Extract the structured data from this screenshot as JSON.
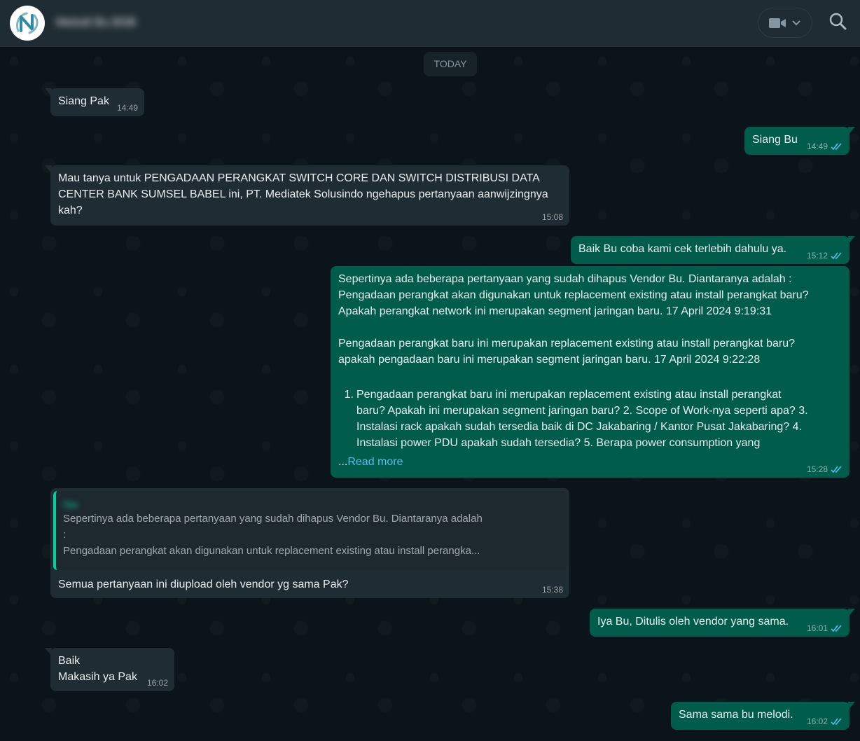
{
  "header": {
    "contact_name": "Melodi Bu BSB",
    "avatar_letter": "N"
  },
  "chat": {
    "date_chip": "TODAY",
    "messages": [
      {
        "dir": "in",
        "text": "Siang Pak",
        "time": "14:49"
      },
      {
        "dir": "out",
        "text": "Siang Bu",
        "time": "14:49"
      },
      {
        "dir": "in",
        "lines": [
          "Mau tanya untuk PENGADAAN PERANGKAT SWITCH CORE DAN SWITCH DISTRIBUSI DATA",
          "CENTER BANK SUMSEL BABEL ini, PT. Mediatek Solusindo ngehapus pertanyaan aanwijzingnya",
          "kah?"
        ],
        "time": "15:08"
      },
      {
        "dir": "out",
        "text": "Baik Bu coba kami cek terlebih dahulu ya.",
        "time": "15:12"
      },
      {
        "dir": "out",
        "para1": [
          "Sepertinya ada beberapa pertanyaan yang sudah dihapus Vendor Bu. Diantaranya adalah :",
          "Pengadaan perangkat akan digunakan untuk replacement existing atau install perangkat baru?",
          "Apakah perangkat network ini merupakan segment jaringan baru. 17 April 2024 9:19:31"
        ],
        "para2": [
          "Pengadaan perangkat baru ini merupakan replacement existing atau install perangkat baru?",
          "apakah pengadaan baru ini merupakan segment jaringan baru. 17 April 2024 9:22:28"
        ],
        "list_number": "1.",
        "list_lines": [
          "Pengadaan perangkat baru ini merupakan replacement existing atau install perangkat",
          "baru? Apakah ini merupakan segment jaringan baru? 2. Scope of Work-nya seperti apa? 3.",
          "Instalasi rack apakah sudah tersedia baik di DC Jakabaring / Kantor Pusat Jakabaring? 4.",
          "Instalasi power PDU apakah sudah tersedia? 5. Berapa power consumption yang"
        ],
        "ellipsis": "...",
        "read_more": "Read more",
        "time": "15:28"
      },
      {
        "dir": "in",
        "quote_author": "Nia",
        "quote_lines": [
          "Sepertinya ada beberapa pertanyaan yang sudah dihapus Vendor Bu. Diantaranya adalah",
          ":",
          "Pengadaan perangkat akan digunakan untuk replacement existing atau install perangka..."
        ],
        "text": "Semua pertanyaan ini diupload oleh vendor yg sama Pak?",
        "time": "15:38"
      },
      {
        "dir": "out",
        "text": "Iya Bu, Ditulis oleh vendor yang sama.",
        "time": "16:01"
      },
      {
        "dir": "in",
        "lines": [
          "Baik",
          "Makasih ya Pak"
        ],
        "time": "16:02"
      },
      {
        "dir": "out",
        "text": "Sama sama bu melodi.",
        "time": "16:02"
      }
    ]
  },
  "colors": {
    "accent": "#00a884",
    "outgoing_bubble": "#005c4b",
    "incoming_bubble": "#202c33",
    "read_ticks": "#53bdeb"
  }
}
